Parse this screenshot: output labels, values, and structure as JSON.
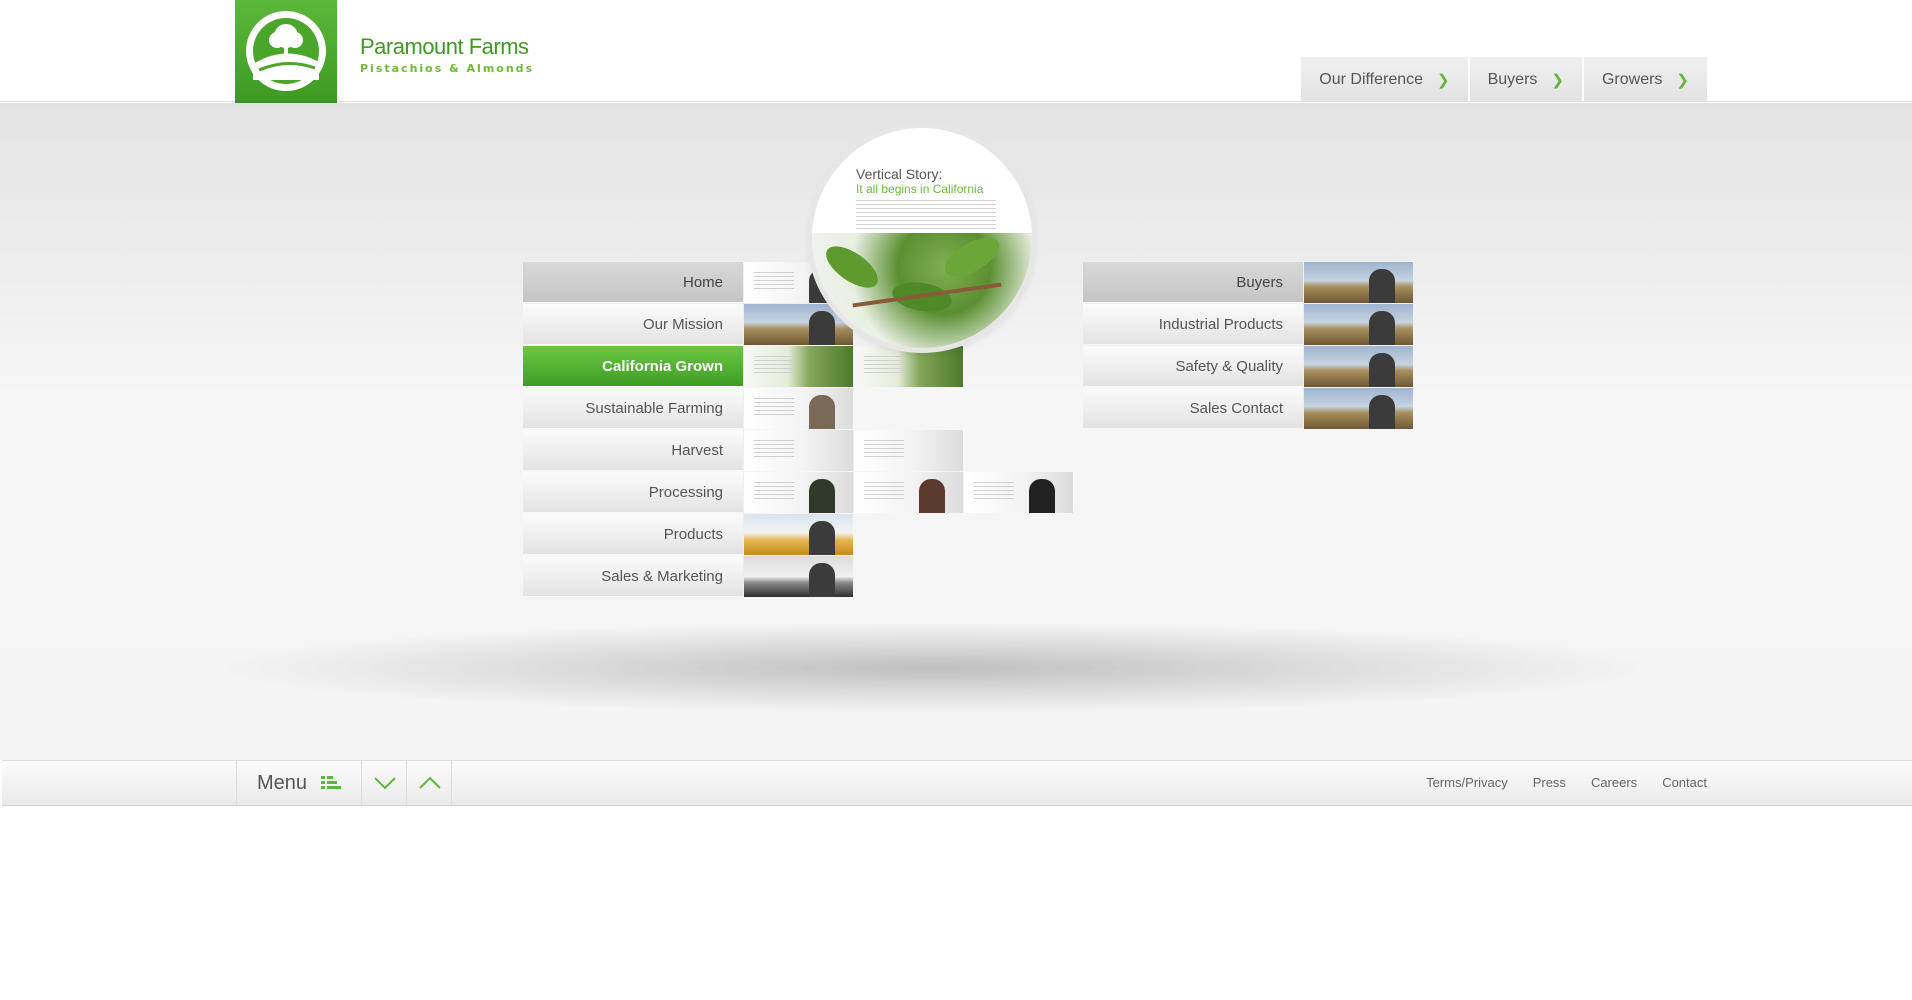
{
  "brand": {
    "name": "Paramount Farms",
    "tagline": "Pistachios & Almonds"
  },
  "topnav": [
    {
      "label": "Our Difference"
    },
    {
      "label": "Buyers"
    },
    {
      "label": "Growers"
    }
  ],
  "preview": {
    "title": "Vertical Story:",
    "subtitle": "It all begins in California"
  },
  "left_menu": [
    {
      "label": "Home"
    },
    {
      "label": "Our Mission"
    },
    {
      "label": "California Grown",
      "active": true
    },
    {
      "label": "Sustainable Farming"
    },
    {
      "label": "Harvest"
    },
    {
      "label": "Processing"
    },
    {
      "label": "Products"
    },
    {
      "label": "Sales & Marketing"
    }
  ],
  "right_menu": [
    {
      "label": "Buyers"
    },
    {
      "label": "Industrial Products"
    },
    {
      "label": "Safety & Quality"
    },
    {
      "label": "Sales Contact"
    }
  ],
  "bottombar": {
    "menu_label": "Menu"
  },
  "footer_links": [
    {
      "label": "Terms/Privacy"
    },
    {
      "label": "Press"
    },
    {
      "label": "Careers"
    },
    {
      "label": "Contact"
    }
  ],
  "colors": {
    "accent": "#4caf2c",
    "text": "#555555"
  },
  "icons": {
    "logo": "tree-logo-icon",
    "topnav_chevron": "chevron-right-icon",
    "menu": "menu-list-icon",
    "down": "chevron-down-icon",
    "up": "chevron-up-icon"
  }
}
